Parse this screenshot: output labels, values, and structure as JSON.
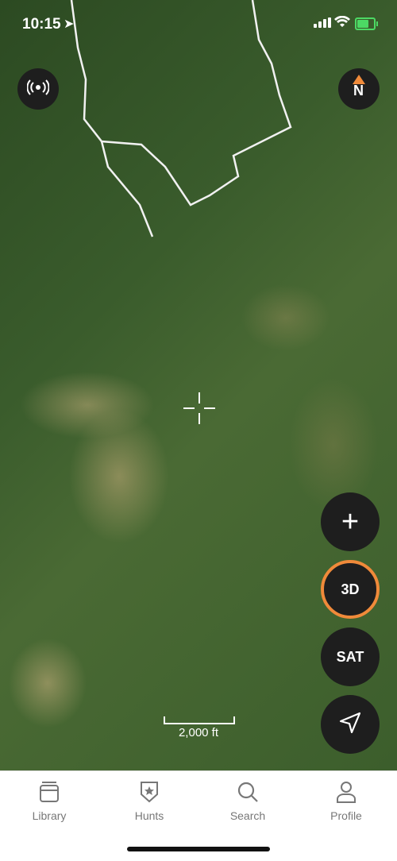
{
  "status_bar": {
    "time": "10:15",
    "location_icon": "location-arrow-icon",
    "cellular_icon": "cellular-signal-icon",
    "wifi_icon": "wifi-icon",
    "battery_icon": "battery-charging-icon",
    "battery_color": "#4cd964",
    "battery_level": 0.8
  },
  "map": {
    "type": "satellite",
    "scale_label": "2,000 ft",
    "crosshair_icon": "crosshair-icon"
  },
  "controls": {
    "live_button_icon": "broadcast-icon",
    "compass_label": "N",
    "add_icon": "plus-icon",
    "add_label": "+",
    "three_d_label": "3D",
    "sat_label": "SAT",
    "navigate_icon": "navigation-arrow-icon",
    "accent_color": "#f08a3a"
  },
  "tabbar": {
    "items": [
      {
        "label": "Library",
        "icon": "library-icon"
      },
      {
        "label": "Hunts",
        "icon": "hunts-badge-icon"
      },
      {
        "label": "Search",
        "icon": "search-icon"
      },
      {
        "label": "Profile",
        "icon": "profile-icon"
      }
    ]
  }
}
